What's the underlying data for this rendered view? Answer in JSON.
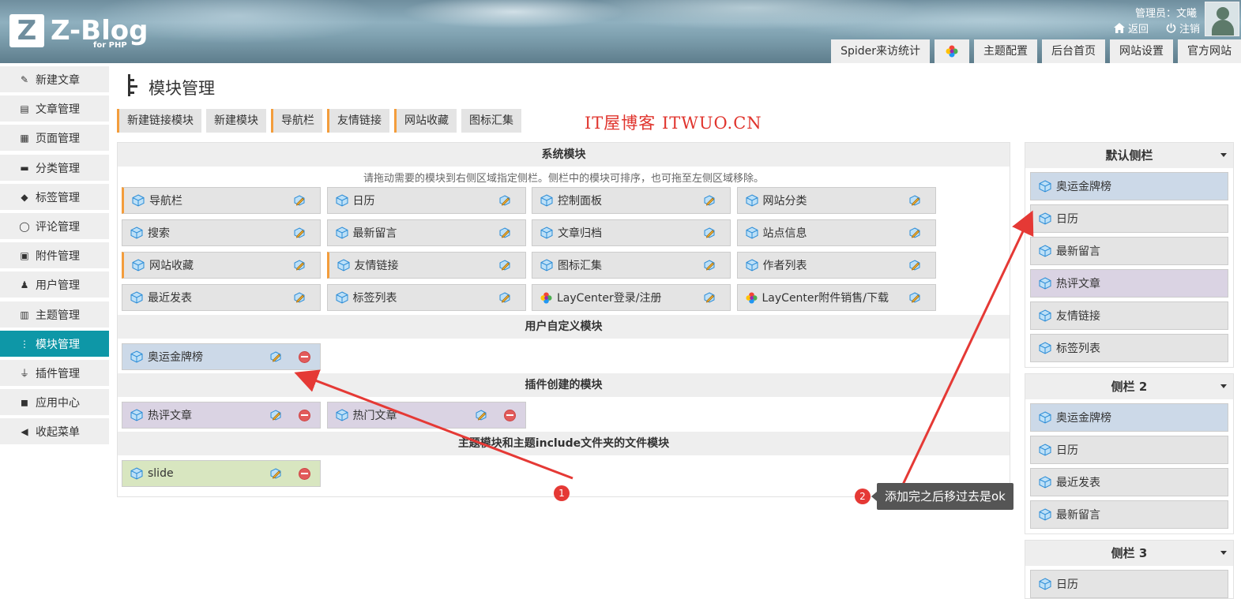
{
  "header": {
    "logo_letter": "Z",
    "logo_text": "Z-Blog",
    "logo_sub": "for PHP",
    "admin_label": "管理员：文曦",
    "back_label": "返回",
    "logout_label": "注销"
  },
  "topnav": [
    "Spider来访统计",
    "主题配置",
    "后台首页",
    "网站设置",
    "官方网站"
  ],
  "sidebar": [
    {
      "label": "新建文章",
      "icon": "edit-icon"
    },
    {
      "label": "文章管理",
      "icon": "articles-icon"
    },
    {
      "label": "页面管理",
      "icon": "pages-icon"
    },
    {
      "label": "分类管理",
      "icon": "folder-icon"
    },
    {
      "label": "标签管理",
      "icon": "tag-icon"
    },
    {
      "label": "评论管理",
      "icon": "comment-icon"
    },
    {
      "label": "附件管理",
      "icon": "attachment-icon"
    },
    {
      "label": "用户管理",
      "icon": "user-icon"
    },
    {
      "label": "主题管理",
      "icon": "theme-icon"
    },
    {
      "label": "模块管理",
      "icon": "module-icon"
    },
    {
      "label": "插件管理",
      "icon": "plugin-icon"
    },
    {
      "label": "应用中心",
      "icon": "app-center-icon"
    },
    {
      "label": "收起菜单",
      "icon": "collapse-icon"
    }
  ],
  "page_title": "模块管理",
  "subtabs": [
    "新建链接模块",
    "新建模块",
    "导航栏",
    "友情链接",
    "网站收藏",
    "图标汇集"
  ],
  "watermark": "IT屋博客 ITWUO.CN",
  "system": {
    "title": "系统模块",
    "hint": "请拖动需要的模块到右侧区域指定侧栏。侧栏中的模块可排序，也可拖至左侧区域移除。",
    "modules": [
      "导航栏",
      "日历",
      "控制面板",
      "网站分类",
      "搜索",
      "最新留言",
      "文章归档",
      "站点信息",
      "网站收藏",
      "友情链接",
      "图标汇集",
      "作者列表",
      "最近发表",
      "标签列表",
      "LayCenter登录/注册",
      "LayCenter附件销售/下载"
    ]
  },
  "user_defined": {
    "title": "用户自定义模块",
    "modules": [
      "奥运金牌榜"
    ]
  },
  "plugin_created": {
    "title": "插件创建的模块",
    "modules": [
      "热评文章",
      "热门文章"
    ]
  },
  "theme_files": {
    "title": "主题模块和主题include文件夹的文件模块",
    "modules": [
      "slide"
    ]
  },
  "sidebars": [
    {
      "title": "默认侧栏",
      "modules": [
        "奥运金牌榜",
        "日历",
        "最新留言",
        "热评文章",
        "友情链接",
        "标签列表"
      ]
    },
    {
      "title": "侧栏 2",
      "modules": [
        "奥运金牌榜",
        "日历",
        "最近发表",
        "最新留言"
      ]
    },
    {
      "title": "侧栏 3",
      "modules": [
        "日历"
      ]
    }
  ],
  "annotations": {
    "badge1": "1",
    "badge2": "2",
    "tooltip": "添加完之后移过去是ok"
  }
}
